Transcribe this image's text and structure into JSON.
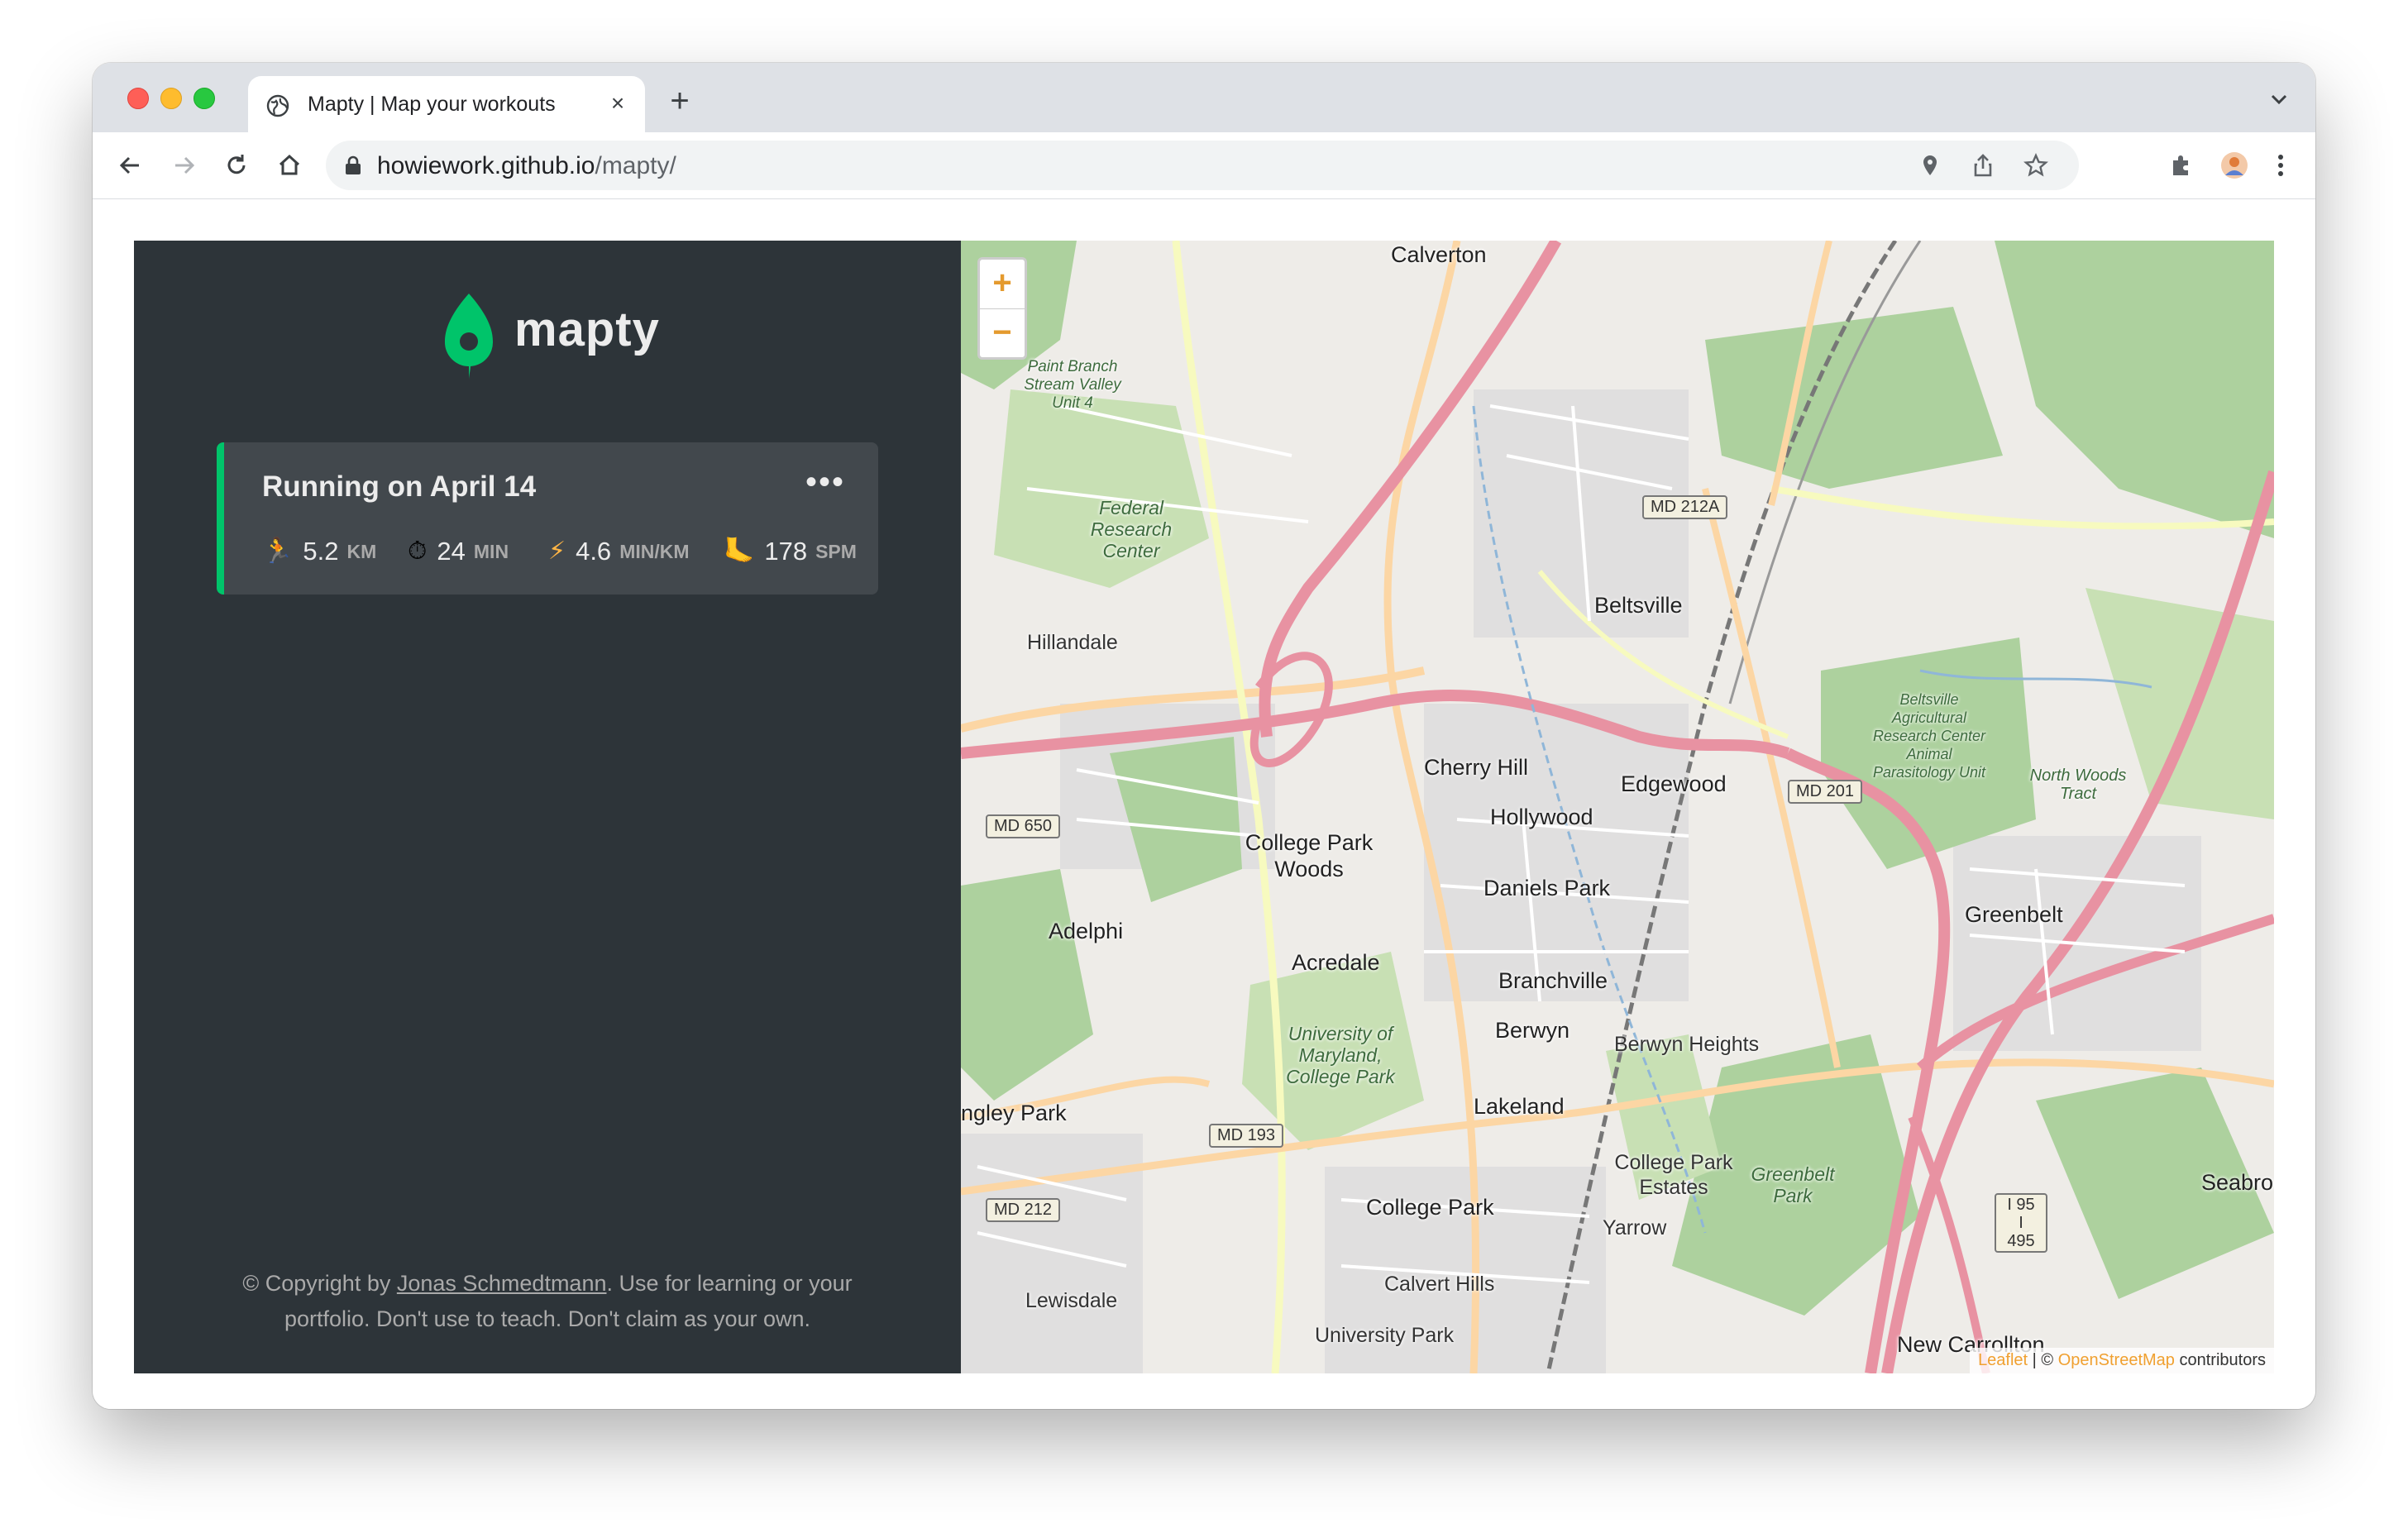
{
  "browser": {
    "tab_title": "Mapty | Map your workouts",
    "url_host": "howiework.github.io",
    "url_path": "/mapty/"
  },
  "sidebar": {
    "logo_text": "mapty",
    "workouts": [
      {
        "title": "Running on April 14",
        "type": "running",
        "accent_color": "#00c46a",
        "details": [
          {
            "icon": "running-icon",
            "value": "5.2",
            "unit": "KM"
          },
          {
            "icon": "stopwatch-icon",
            "value": "24",
            "unit": "MIN"
          },
          {
            "icon": "lightning-icon",
            "value": "4.6",
            "unit": "MIN/KM"
          },
          {
            "icon": "footprint-icon",
            "value": "178",
            "unit": "SPM"
          }
        ]
      }
    ],
    "copyright_prefix": "© Copyright by ",
    "copyright_link": "Jonas Schmedtmann",
    "copyright_suffix": ". Use for learning or your portfolio. Don't use to teach. Don't claim as your own."
  },
  "map": {
    "zoom_in": "+",
    "zoom_out": "−",
    "attribution_leaflet": "Leaflet",
    "attribution_sep": " | © ",
    "attribution_osm": "OpenStreetMap",
    "attribution_suffix": " contributors",
    "places": [
      "Calverton",
      "Beltsville",
      "Hillandale",
      "Cherry Hill",
      "Edgewood",
      "Hollywood",
      "College Park Woods",
      "Daniels Park",
      "Adelphi",
      "Acredale",
      "Branchville",
      "Greenbelt",
      "Berwyn",
      "Berwyn Heights",
      "Lakeland",
      "College Park Estates",
      "College Park",
      "Yarrow",
      "Calvert Hills",
      "University Park",
      "Lewisdale",
      "ngley Park",
      "New Carrollton",
      "Seabroo"
    ],
    "areas": [
      "Federal Research Center",
      "Paint Branch Stream Valley Unit 4",
      "University of Maryland, College Park",
      "Greenbelt Park",
      "Beltsville Agricultural Research Center Animal Parasitology Unit",
      "North Woods Tract"
    ],
    "shields": [
      "MD 212A",
      "MD 650",
      "MD 201",
      "MD 193",
      "MD 212",
      "I 95 I 495"
    ],
    "colors": {
      "motorway": "#e892a2",
      "primary": "#fcd6a4",
      "park": "#c8e0b4",
      "forest": "#add19e",
      "rail": "#777777"
    }
  }
}
